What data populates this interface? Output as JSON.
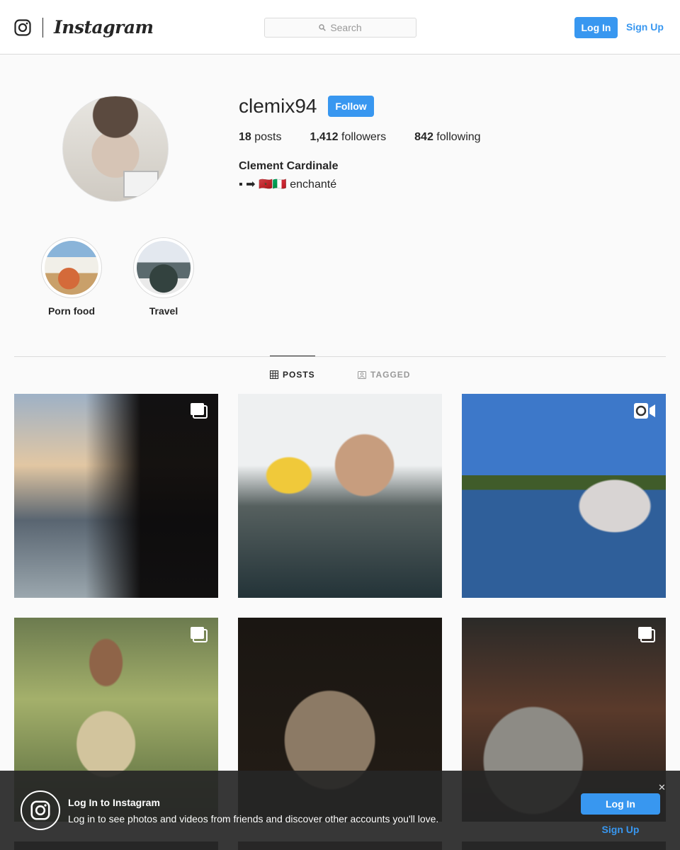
{
  "header": {
    "brand": "Instagram",
    "search_placeholder": "Search",
    "login_label": "Log In",
    "signup_label": "Sign Up"
  },
  "profile": {
    "username": "clemix94",
    "follow_label": "Follow",
    "stats": [
      {
        "count": "18",
        "label": "posts"
      },
      {
        "count": "1,412",
        "label": "followers"
      },
      {
        "count": "842",
        "label": "following"
      }
    ],
    "full_name": "Clement Cardinale",
    "bio": "▪ ➡ 🇲🇦🇮🇹 enchanté"
  },
  "highlights": [
    {
      "label": "Porn food"
    },
    {
      "label": "Travel"
    }
  ],
  "tabs": [
    {
      "label": "POSTS",
      "icon": "grid-icon",
      "active": true
    },
    {
      "label": "TAGGED",
      "icon": "tagged-icon",
      "active": false
    }
  ],
  "posts": [
    {
      "badge": "carousel-icon"
    },
    {
      "badge": ""
    },
    {
      "badge": "video-icon"
    },
    {
      "badge": "carousel-icon"
    },
    {
      "badge": ""
    },
    {
      "badge": "carousel-icon"
    }
  ],
  "banner": {
    "title": "Log In to Instagram",
    "text": "Log in to see photos and videos from friends and discover other accounts you'll love.",
    "login_label": "Log In",
    "signup_label": "Sign Up",
    "close_symbol": "✕"
  },
  "colors": {
    "accent": "#3897f0",
    "text": "#262626",
    "muted": "#999999",
    "border": "#dbdbdb",
    "background": "#fafafa"
  }
}
